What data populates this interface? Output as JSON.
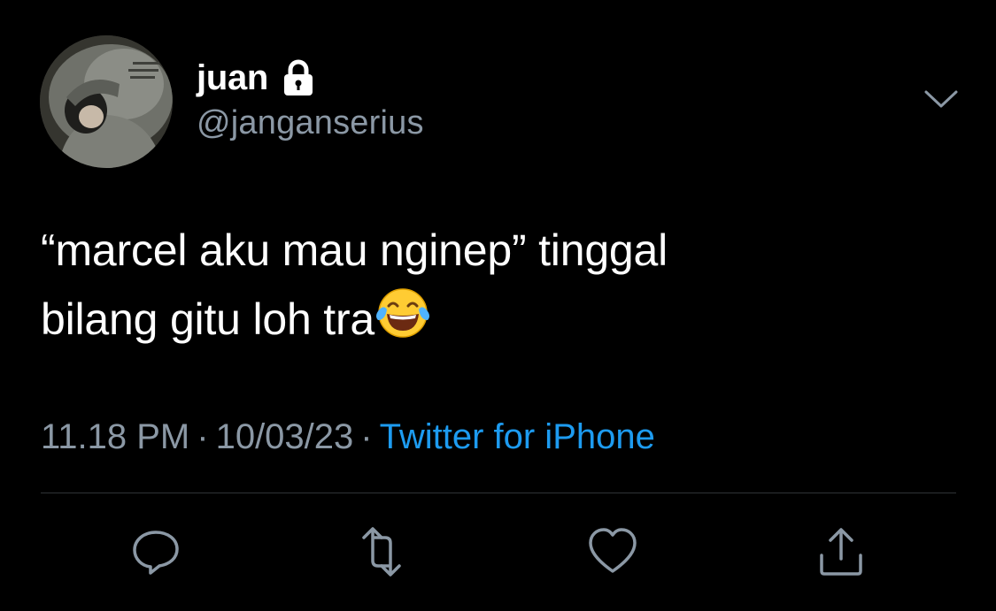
{
  "author": {
    "display_name": "juan",
    "handle": "@janganserius",
    "locked_icon": "lock-icon",
    "avatar": "avatar-photo"
  },
  "tweet": {
    "line1": "“marcel aku mau nginep” tinggal",
    "line2": "bilang gitu loh tra",
    "emoji": "face-with-tears-of-joy"
  },
  "meta": {
    "time": "11.18 PM",
    "date": "10/03/23",
    "separator": "·",
    "source": "Twitter for iPhone"
  },
  "actions": [
    "reply-icon",
    "retweet-icon",
    "like-icon",
    "share-icon"
  ],
  "colors": {
    "background": "#000000",
    "text": "#ffffff",
    "secondary": "#8b98a5",
    "accent": "#1d9bf0",
    "divider": "#2f3336"
  }
}
